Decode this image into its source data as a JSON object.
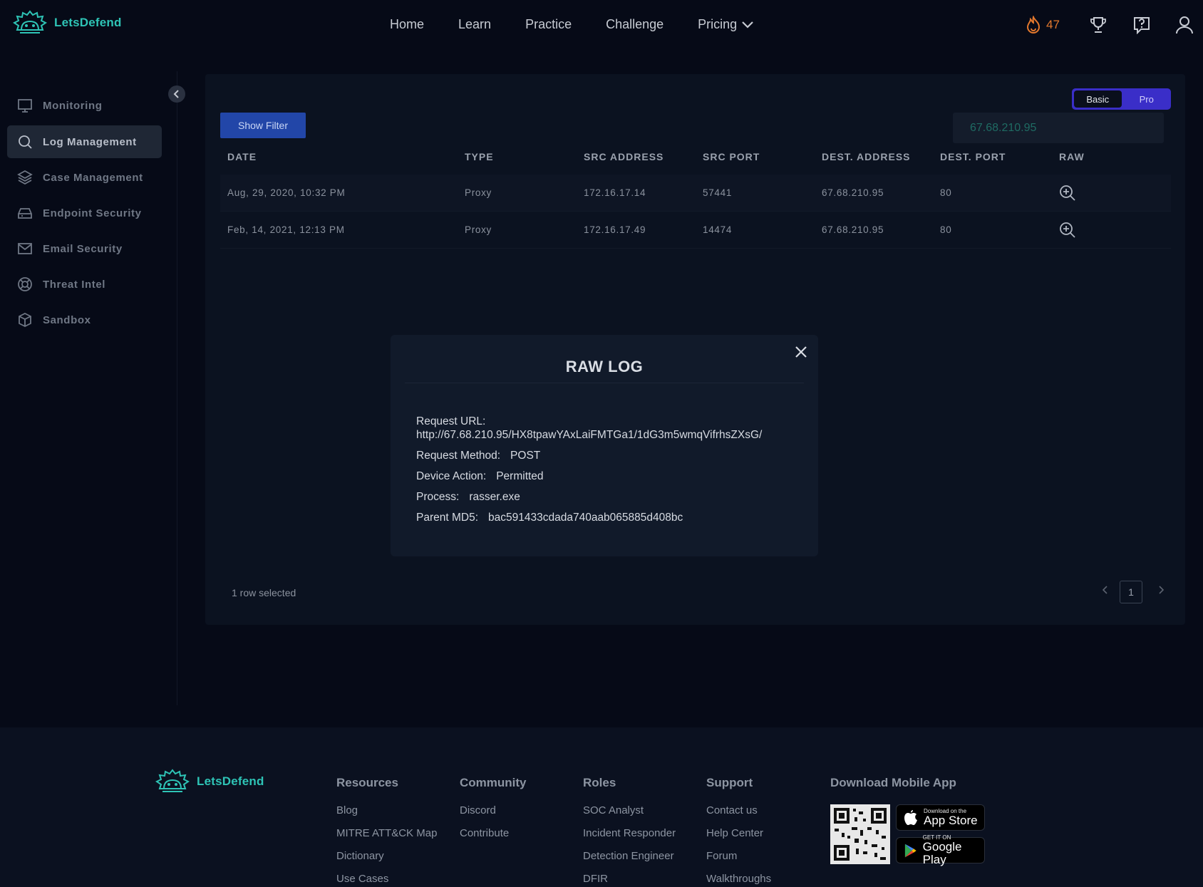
{
  "brand": {
    "name": "LetsDefend"
  },
  "nav": {
    "items": [
      "Home",
      "Learn",
      "Practice",
      "Challenge",
      "Pricing"
    ]
  },
  "topbar": {
    "streak": "47"
  },
  "sidebar": {
    "items": [
      {
        "label": "Monitoring",
        "icon": "monitor-icon"
      },
      {
        "label": "Log Management",
        "icon": "search-icon"
      },
      {
        "label": "Case Management",
        "icon": "layers-icon"
      },
      {
        "label": "Endpoint Security",
        "icon": "drive-icon"
      },
      {
        "label": "Email Security",
        "icon": "mail-icon"
      },
      {
        "label": "Threat Intel",
        "icon": "lifebuoy-icon"
      },
      {
        "label": "Sandbox",
        "icon": "cube-icon"
      }
    ],
    "active_index": 1
  },
  "toolbar": {
    "show_filter": "Show Filter",
    "toggle": {
      "basic": "Basic",
      "pro": "Pro",
      "selected": "Basic"
    },
    "search_value": "67.68.210.95"
  },
  "table": {
    "columns": [
      "DATE",
      "TYPE",
      "SRC ADDRESS",
      "SRC PORT",
      "DEST. ADDRESS",
      "DEST. PORT",
      "RAW"
    ],
    "rows": [
      {
        "date": "Aug, 29, 2020, 10:32 PM",
        "type": "Proxy",
        "src_address": "172.16.17.14",
        "src_port": "57441",
        "dest_address": "67.68.210.95",
        "dest_port": "80"
      },
      {
        "date": "Feb, 14, 2021, 12:13 PM",
        "type": "Proxy",
        "src_address": "172.16.17.49",
        "src_port": "14474",
        "dest_address": "67.68.210.95",
        "dest_port": "80"
      }
    ],
    "rows_selected": "1 row selected",
    "page": "1"
  },
  "modal": {
    "title": "RAW LOG",
    "request_url_label": "Request URL:",
    "request_url": "http://67.68.210.95/HX8tpawYAxLaiFMTGa1/1dG3m5wmqVifrhsZXsG/",
    "method_label": "Request Method:",
    "method": "POST",
    "action_label": "Device Action:",
    "action": "Permitted",
    "process_label": "Process:",
    "process": "rasser.exe",
    "md5_label": "Parent MD5:",
    "md5": "bac591433cdada740aab065885d408bc"
  },
  "footer": {
    "brand": "LetsDefend",
    "columns": [
      {
        "title": "Resources",
        "links": [
          "Blog",
          "MITRE ATT&CK Map",
          "Dictionary",
          "Use Cases"
        ]
      },
      {
        "title": "Community",
        "links": [
          "Discord",
          "Contribute"
        ]
      },
      {
        "title": "Roles",
        "links": [
          "SOC Analyst",
          "Incident Responder",
          "Detection Engineer",
          "DFIR"
        ]
      },
      {
        "title": "Support",
        "links": [
          "Contact us",
          "Help Center",
          "Forum",
          "Walkthroughs"
        ]
      }
    ],
    "mobile": {
      "title": "Download Mobile App",
      "app_store_small": "Download on the",
      "app_store_big": "App Store",
      "google_small": "GET IT ON",
      "google_big": "Google Play"
    }
  },
  "colors": {
    "accent": "#2ec4b6",
    "primary_button": "#2246a8",
    "pro_toggle": "#3a2ec8",
    "streak": "#e3782d"
  }
}
